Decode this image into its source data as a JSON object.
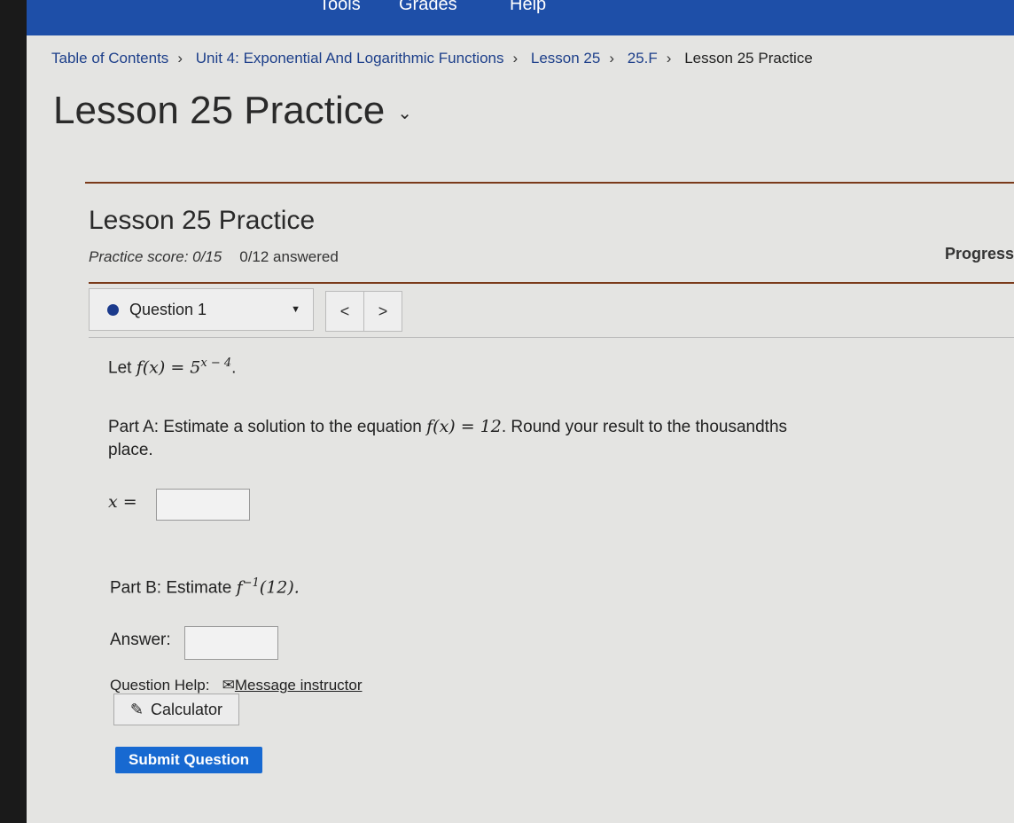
{
  "topnav": {
    "items": [
      "Tools",
      "Grades",
      "Help"
    ]
  },
  "breadcrumb": [
    "Table of Contents",
    "Unit 4: Exponential And Logarithmic Functions",
    "Lesson 25",
    "25.F",
    "Lesson 25 Practice"
  ],
  "page_title": "Lesson 25 Practice",
  "assignment": {
    "title": "Lesson 25 Practice",
    "score": "Practice score: 0/15",
    "answered": "0/12 answered",
    "progress_label": "Progress"
  },
  "question_nav": {
    "selected": "Question 1",
    "prev": "<",
    "next": ">"
  },
  "question": {
    "intro_label": "Let",
    "intro_math": "f(x) = 5",
    "intro_exp": "x − 4",
    "partA_text": "Part A: Estimate a solution to the equation",
    "partA_math": "f(x) = 12",
    "partA_rest": ". Round your result to the thousandths",
    "partA_rest2": "place.",
    "partA_answer_label": "x =",
    "partA_answer_value": "",
    "partB_text": "Part B: Estimate",
    "partB_math": "f",
    "partB_exp": "−1",
    "partB_arg": "(12).",
    "partB_answer_label": "Answer:",
    "partB_answer_value": ""
  },
  "help": {
    "label": "Question Help:",
    "message": "Message instructor",
    "calculator": "Calculator"
  },
  "submit": "Submit Question"
}
